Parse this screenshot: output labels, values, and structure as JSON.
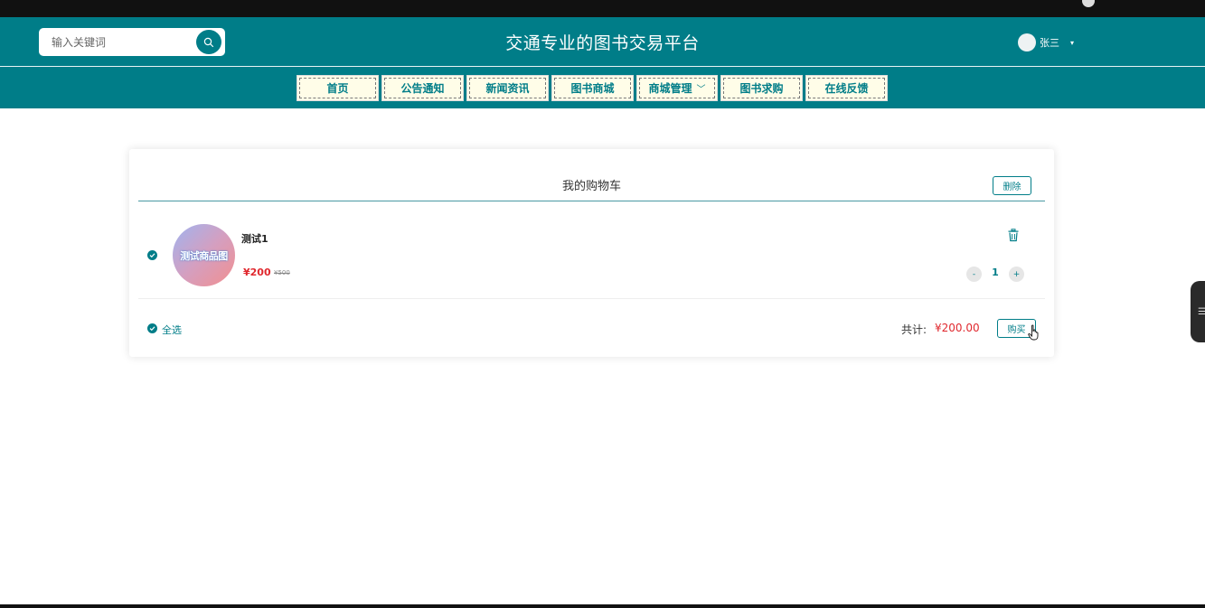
{
  "header": {
    "title": "交通专业的图书交易平台",
    "search_placeholder": "输入关键词",
    "search_icon": "search-icon",
    "user_name": "张三",
    "user_caret": "▾"
  },
  "nav": {
    "items": [
      {
        "label": "首页"
      },
      {
        "label": "公告通知"
      },
      {
        "label": "新闻资讯"
      },
      {
        "label": "图书商城"
      },
      {
        "label": "商城管理",
        "dropdown": true,
        "chevron": "﹀"
      },
      {
        "label": "图书求购"
      },
      {
        "label": "在线反馈"
      }
    ]
  },
  "cart": {
    "title": "我的购物车",
    "delete_label": "删除",
    "item": {
      "name": "测试1",
      "image_text": "测试商品图",
      "price": "¥200",
      "original_price": "¥500",
      "quantity": "1",
      "minus": "-",
      "plus": "+",
      "selected": true
    },
    "select_all_label": "全选",
    "total_label": "共计:",
    "total_value": "¥200.00",
    "buy_label": "购买"
  },
  "colors": {
    "primary": "#007d88",
    "price": "#e0282e",
    "nav_bg": "#fffde8"
  }
}
